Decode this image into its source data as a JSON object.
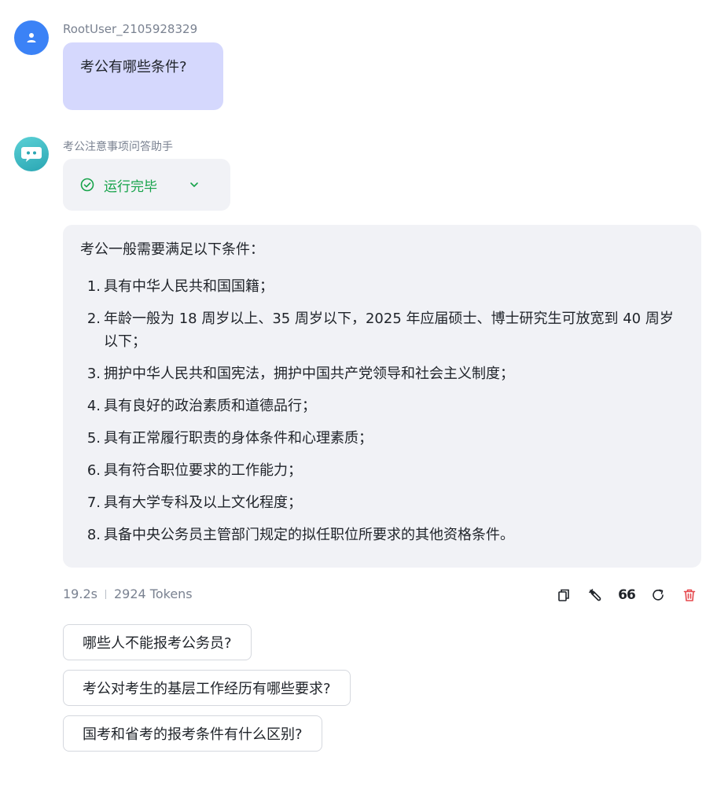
{
  "user": {
    "name": "RootUser_2105928329",
    "message": "考公有哪些条件?"
  },
  "assistant": {
    "name": "考公注意事项问答助手",
    "status": "运行完毕",
    "intro": "考公一般需要满足以下条件：",
    "items": [
      {
        "num": "1.",
        "text": "具有中华人民共和国国籍；"
      },
      {
        "num": "2.",
        "text": "年龄一般为 18 周岁以上、35 周岁以下，2025 年应届硕士、博士研究生可放宽到 40 周岁以下；"
      },
      {
        "num": "3.",
        "text": "拥护中华人民共和国宪法，拥护中国共产党领导和社会主义制度；"
      },
      {
        "num": "4.",
        "text": "具有良好的政治素质和道德品行；"
      },
      {
        "num": "5.",
        "text": "具有正常履行职责的身体条件和心理素质；"
      },
      {
        "num": "6.",
        "text": "具有符合职位要求的工作能力；"
      },
      {
        "num": "7.",
        "text": "具有大学专科及以上文化程度；"
      },
      {
        "num": "8.",
        "text": "具备中央公务员主管部门规定的拟任职位所要求的其他资格条件。"
      }
    ],
    "time": "19.2s",
    "tokens": "2924 Tokens"
  },
  "actions": {
    "quote_label": "66"
  },
  "suggestions": [
    "哪些人不能报考公务员?",
    "考公对考生的基层工作经历有哪些要求?",
    "国考和省考的报考条件有什么区别?"
  ],
  "colors": {
    "user_bubble": "#d5d8fd",
    "status_green": "#16a34a",
    "delete_red": "#e5484d",
    "user_avatar": "#3b82f6",
    "panel_bg": "#f1f2f6"
  },
  "icons": [
    "user-icon",
    "bot-icon",
    "check-circle-icon",
    "chevron-down-icon",
    "copy-icon",
    "wrench-icon",
    "quote-icon",
    "refresh-icon",
    "trash-icon"
  ]
}
